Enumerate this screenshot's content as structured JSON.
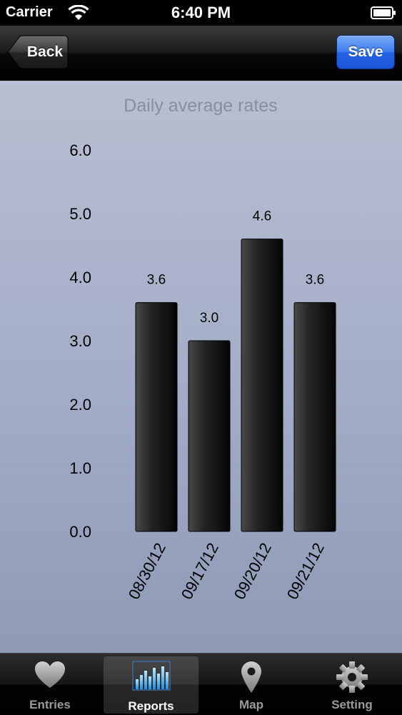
{
  "status_bar": {
    "carrier": "Carrier",
    "time": "6:40 PM"
  },
  "nav_bar": {
    "back_label": "Back",
    "save_label": "Save"
  },
  "chart_data": {
    "type": "bar",
    "title": "Daily average rates",
    "categories": [
      "08/30/12",
      "09/17/12",
      "09/20/12",
      "09/21/12"
    ],
    "values": [
      3.6,
      3.0,
      4.6,
      3.6
    ],
    "value_labels": [
      "3.6",
      "3.0",
      "4.6",
      "3.6"
    ],
    "y_ticks": [
      "0.0",
      "1.0",
      "2.0",
      "3.0",
      "4.0",
      "5.0",
      "6.0"
    ],
    "ylim": [
      0,
      6
    ],
    "grid": false,
    "bar_color": "#1a1a1a"
  },
  "tab_bar": {
    "tabs": [
      {
        "label": "Entries",
        "icon": "heart-icon"
      },
      {
        "label": "Reports",
        "icon": "bar-chart-icon"
      },
      {
        "label": "Map",
        "icon": "map-pin-icon"
      },
      {
        "label": "Setting",
        "icon": "gear-icon"
      }
    ],
    "selected": "Reports"
  }
}
